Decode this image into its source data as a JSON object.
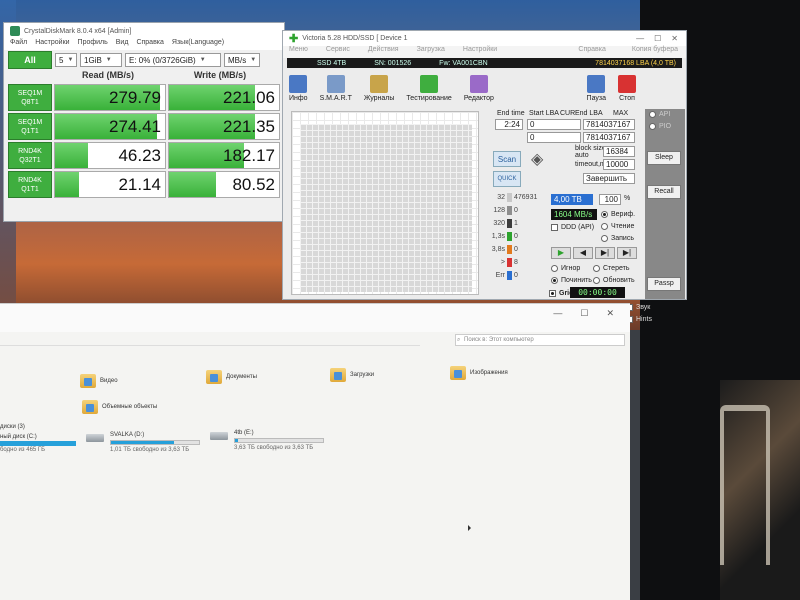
{
  "cdm": {
    "title": "CrystalDiskMark 8.0.4 x64 [Admin]",
    "menu": [
      "Файл",
      "Настройки",
      "Профиль",
      "Вид",
      "Справка",
      "Язык(Language)"
    ],
    "all_label": "All",
    "count": "5",
    "size": "1GiB",
    "target": "E: 0% (0/3726GiB)",
    "unit": "MB/s",
    "read_header": "Read (MB/s)",
    "write_header": "Write (MB/s)",
    "rows": [
      {
        "line1": "SEQ1M",
        "line2": "Q8T1",
        "read": "279.79",
        "write": "221.06",
        "read_frac": 0.95,
        "write_frac": 0.78
      },
      {
        "line1": "SEQ1M",
        "line2": "Q1T1",
        "read": "274.41",
        "write": "221.35",
        "read_frac": 0.93,
        "write_frac": 0.78
      },
      {
        "line1": "RND4K",
        "line2": "Q32T1",
        "read": "46.23",
        "write": "182.17",
        "read_frac": 0.3,
        "write_frac": 0.68
      },
      {
        "line1": "RND4K",
        "line2": "Q1T1",
        "read": "21.14",
        "write": "80.52",
        "read_frac": 0.22,
        "write_frac": 0.43
      }
    ]
  },
  "victoria": {
    "title": "Victoria 5.28 HDD/SSD [ Device 1",
    "menu": [
      "Меню",
      "Сервис",
      "Действия",
      "Загрузка",
      "Настройки"
    ],
    "menu_right": [
      "Справка",
      "Копия буфера"
    ],
    "device": "SSD 4TB",
    "sn": "SN: 001526",
    "fw": "Fw: VA001CBN",
    "lba_info": "7814037168 LBA (4,0 TB)",
    "tools": [
      "Инфо",
      "S.M.A.R.T",
      "Журналы",
      "Тестирование",
      "Редактор"
    ],
    "pause": "Пауза",
    "stop": "Стоп",
    "end_time_label": "End time",
    "end_time": "2:24",
    "start_lba_label": "Start LBA",
    "end_lba_label": "End LBA",
    "cur_label": "CUR",
    "max_label": "MAX",
    "start_lba": "0",
    "cur_lba": "0",
    "end_lba": "7814037167",
    "end_lba2": "7814037167",
    "block_size_label": "block size",
    "auto_label": "auto",
    "block_size": "16384",
    "timeout_label": "timeout,ms",
    "timeout": "10000",
    "scan_label": "Scan",
    "quick_label": "QUICK",
    "finish_label": "Завершить",
    "legend": [
      {
        "ms": "32",
        "count": "476931",
        "color": "#c8c8c8"
      },
      {
        "ms": "128",
        "count": "0",
        "color": "#8e8e8e"
      },
      {
        "ms": "320",
        "count": "1",
        "color": "#3c3c3c"
      },
      {
        "ms": "1,3s",
        "count": "0",
        "color": "#2ea32e"
      },
      {
        "ms": "3,8s",
        "count": "0",
        "color": "#e27a1e"
      },
      {
        "ms": ">",
        "count": "8",
        "color": "#d83232"
      },
      {
        "ms": "Err",
        "count": "0",
        "color": "#2a6fd1"
      }
    ],
    "capacity": "4,00 TB",
    "percent": "100",
    "percent_unit": "%",
    "speed": "1604 MB/s",
    "verify_label": "Вериф.",
    "read_label": "Чтение",
    "write_label": "Запись",
    "ddd_label": "DDD (API)",
    "ignore_label": "Игнор",
    "erase_label": "Стереть",
    "remap_label": "Починить",
    "refresh_label": "Обновить",
    "grid_label": "Grid",
    "timer": "00:00:00",
    "side": {
      "api": "API",
      "pio": "PIO",
      "sleep": "Sleep",
      "recall": "Recall",
      "passp": "Passp",
      "sound": "Звук",
      "hints": "Hints"
    }
  },
  "explorer": {
    "search_placeholder": "Поиск в: Этот компьютер",
    "folders": [
      "Видео",
      "Документы",
      "Загрузки",
      "Изображения",
      "Объемные объекты"
    ],
    "section_disks": "диски (3)",
    "left_disk_name": "ный диск (C:)",
    "left_disk_free": "бодно из 465 ГБ",
    "drives": [
      {
        "name": "SVALKA (D:)",
        "free": "1,01 ТБ свободно из 3,63 ТБ",
        "fill": 0.72
      },
      {
        "name": "4tb (E:)",
        "free": "3,63 ТБ свободно из 3,63 ТБ",
        "fill": 0.03
      }
    ]
  }
}
